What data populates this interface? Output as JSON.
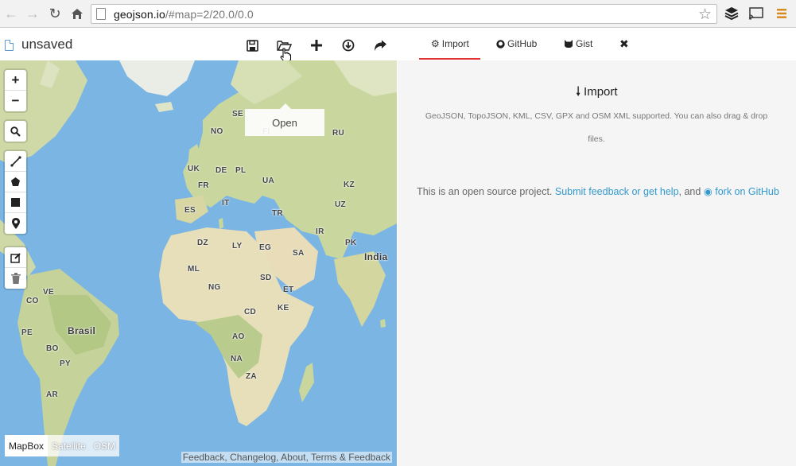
{
  "browser": {
    "url_host": "geojson.io",
    "url_path": "/#map=2/20.0/0.0"
  },
  "file": {
    "name": "unsaved"
  },
  "toolbar": {
    "tooltip": "Open"
  },
  "map": {
    "layers": [
      "MapBox",
      "Satellite",
      "OSM"
    ],
    "active_layer": "MapBox",
    "attribution": "Feedback, Changelog, About, Terms & Feedback",
    "labels": [
      "SE",
      "NO",
      "FI",
      "RU",
      "UK",
      "DE",
      "PL",
      "UA",
      "FR",
      "IT",
      "ES",
      "TR",
      "KZ",
      "UZ",
      "DZ",
      "LY",
      "EG",
      "SA",
      "IR",
      "PK",
      "India",
      "ML",
      "NG",
      "SD",
      "ET",
      "KE",
      "CD",
      "AO",
      "NA",
      "ZA",
      "VE",
      "CO",
      "PE",
      "BO",
      "PY",
      "AR",
      "Brasil"
    ]
  },
  "panel": {
    "tabs": [
      "Import",
      "GitHub",
      "Gist"
    ],
    "active_tab": "Import",
    "import_title": "Import",
    "import_desc": "GeoJSON, TopoJSON, KML, CSV, GPX and OSM XML supported. You can also drag & drop files.",
    "about_prefix": "This is an open source project.",
    "about_link1": "Submit feedback or get help",
    "about_mid": ", and",
    "about_link2": "fork on GitHub"
  },
  "colors": {
    "water": "#7bb5e4",
    "tab_accent": "#e03333",
    "link": "#3399cc"
  }
}
